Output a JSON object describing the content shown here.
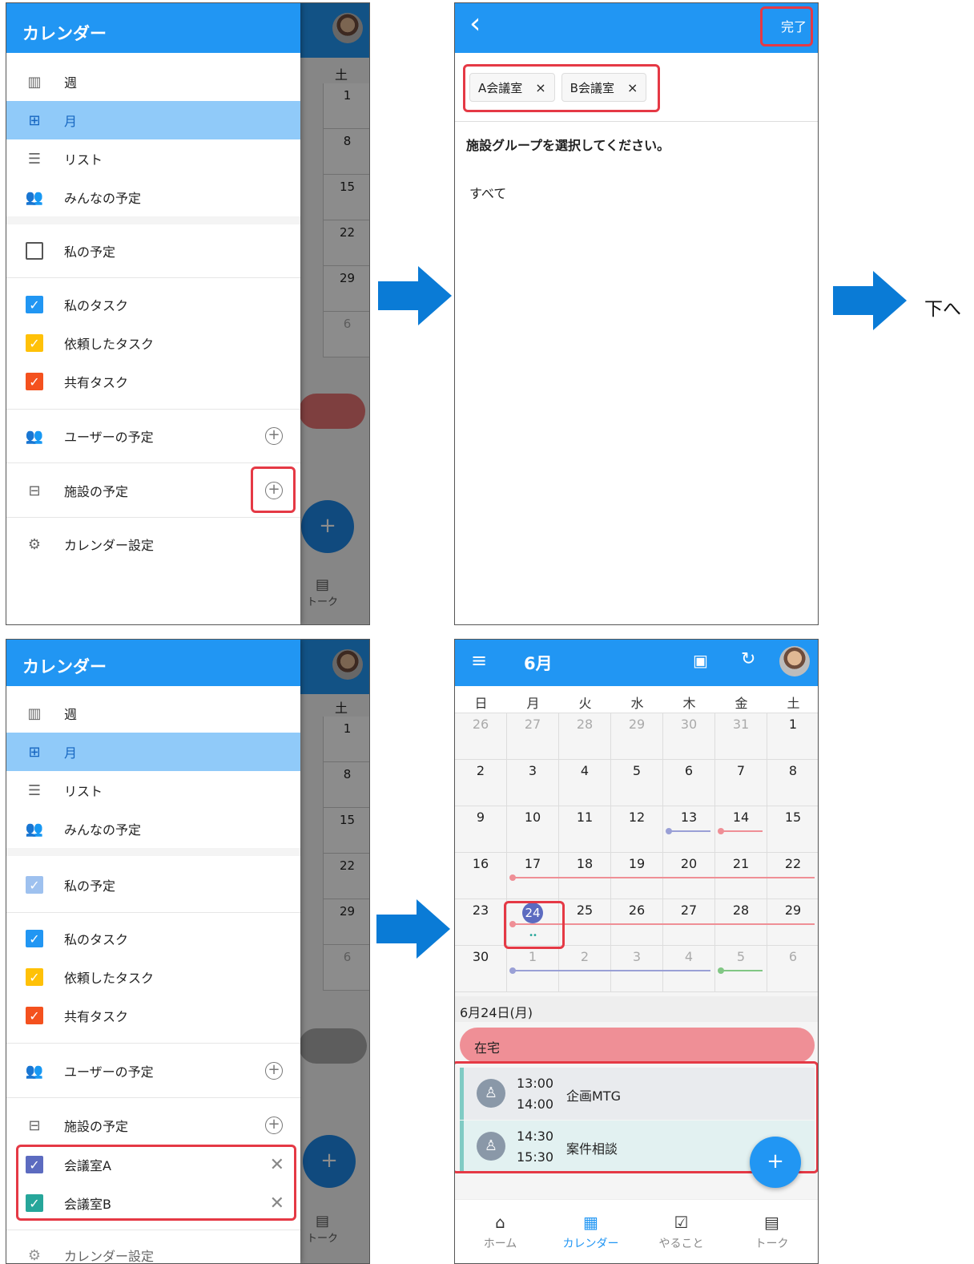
{
  "drawer": {
    "title": "カレンダー",
    "views": [
      {
        "label": "週",
        "icon": "week-columns-icon"
      },
      {
        "label": "月",
        "icon": "month-grid-icon"
      },
      {
        "label": "リスト",
        "icon": "list-icon"
      },
      {
        "label": "みんなの予定",
        "icon": "people-icon"
      }
    ],
    "my_schedule": "私の予定",
    "tasks": [
      {
        "label": "私のタスク",
        "color": "#2196f3"
      },
      {
        "label": "依頼したタスク",
        "color": "#ffc107"
      },
      {
        "label": "共有タスク",
        "color": "#f4511e"
      }
    ],
    "user_schedule": "ユーザーの予定",
    "facility_schedule": "施設の予定",
    "settings": "カレンダー設定",
    "facilities": [
      {
        "label": "会議室A",
        "color": "#5c6bc0"
      },
      {
        "label": "会議室B",
        "color": "#26a69a"
      }
    ],
    "check_mark": "✓"
  },
  "background_app": {
    "sat_label": "土",
    "dates": [
      "1",
      "8",
      "15",
      "22",
      "29",
      "6"
    ],
    "nav_talk": "トーク",
    "fab": "+"
  },
  "selector": {
    "back": "‹",
    "done": "完了",
    "chips": [
      {
        "label": "A会議室",
        "x": "×"
      },
      {
        "label": "B会議室",
        "x": "×"
      }
    ],
    "prompt": "施設グループを選択してください。",
    "option_all": "すべて"
  },
  "next_label": "下へ",
  "calendar": {
    "month_title": "6月",
    "weekdays": [
      "日",
      "月",
      "火",
      "水",
      "木",
      "金",
      "土"
    ],
    "weeks": [
      [
        "26",
        "27",
        "28",
        "29",
        "30",
        "31",
        "1"
      ],
      [
        "2",
        "3",
        "4",
        "5",
        "6",
        "7",
        "8"
      ],
      [
        "9",
        "10",
        "11",
        "12",
        "13",
        "14",
        "15"
      ],
      [
        "16",
        "17",
        "18",
        "19",
        "20",
        "21",
        "22"
      ],
      [
        "23",
        "24",
        "25",
        "26",
        "27",
        "28",
        "29"
      ],
      [
        "30",
        "1",
        "2",
        "3",
        "4",
        "5",
        "6"
      ]
    ],
    "selected_date": "6月24日(月)",
    "all_day_event": "在宅",
    "events": [
      {
        "start": "13:00",
        "end": "14:00",
        "title": "企画MTG"
      },
      {
        "start": "14:30",
        "end": "15:30",
        "title": "案件相談"
      }
    ],
    "fab": "+",
    "nav": [
      {
        "label": "ホーム",
        "icon": "home-icon"
      },
      {
        "label": "カレンダー",
        "icon": "calendar-icon"
      },
      {
        "label": "やること",
        "icon": "todo-icon"
      },
      {
        "label": "トーク",
        "icon": "chat-icon"
      }
    ],
    "colors": {
      "primary": "#2196f3",
      "allday": "#ef8f96",
      "event1_bg": "#e9ebee",
      "event2_bg": "#e2f1f1",
      "line_red": "#ef8f96",
      "line_purple": "#9aa0d6",
      "line_green": "#81c784"
    }
  }
}
